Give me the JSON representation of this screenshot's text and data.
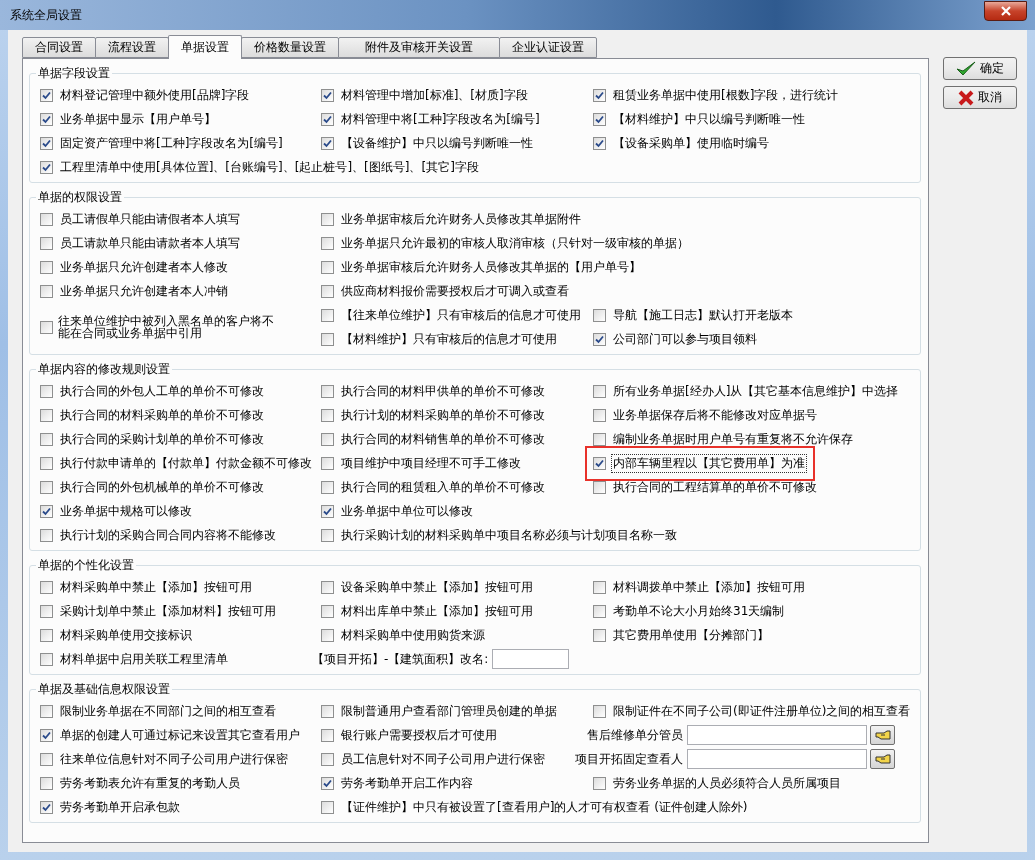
{
  "window": {
    "title": "系统全局设置"
  },
  "tabs": [
    {
      "label": "合同设置",
      "selected": false
    },
    {
      "label": "流程设置",
      "selected": false
    },
    {
      "label": "单据设置",
      "selected": true
    },
    {
      "label": "价格数量设置",
      "selected": false
    },
    {
      "label": "附件及审核开关设置",
      "selected": false
    },
    {
      "label": "企业认证设置",
      "selected": false
    }
  ],
  "buttons": [
    {
      "label": "确定",
      "kind": "ok"
    },
    {
      "label": "取消",
      "kind": "cancel"
    }
  ],
  "groups": [
    {
      "title": "单据字段设置",
      "items": [
        {
          "kind": "checkbox",
          "label": "材料登记管理中额外使用[品牌]字段",
          "checked": true
        },
        {
          "kind": "checkbox",
          "label": "材料管理中增加[标准]、[材质]字段",
          "checked": true
        },
        {
          "kind": "checkbox",
          "label": "租赁业务单据中使用[根数]字段，进行统计",
          "checked": true
        },
        {
          "kind": "checkbox",
          "label": "业务单据中显示【用户单号】",
          "checked": true
        },
        {
          "kind": "checkbox",
          "label": "材料管理中将[工种]字段改名为[编号]",
          "checked": true
        },
        {
          "kind": "checkbox",
          "label": "【材料维护】中只以编号判断唯一性",
          "checked": true
        },
        {
          "kind": "checkbox",
          "label": "固定资产管理中将[工种]字段改名为[编号]",
          "checked": true
        },
        {
          "kind": "checkbox",
          "label": "【设备维护】中只以编号判断唯一性",
          "checked": true
        },
        {
          "kind": "checkbox",
          "label": "【设备采购单】使用临时编号",
          "checked": true
        },
        {
          "kind": "checkbox",
          "label": "工程里清单中使用[具体位置]、[台账编号]、[起止桩号]、[图纸号]、[其它]字段",
          "checked": true
        }
      ]
    },
    {
      "title": "单据的权限设置",
      "items": [
        {
          "kind": "checkbox",
          "label": "员工请假单只能由请假者本人填写",
          "checked": false
        },
        {
          "kind": "checkbox",
          "label": "业务单据审核后允许财务人员修改其单据附件",
          "checked": false
        },
        {
          "kind": "blank"
        },
        {
          "kind": "checkbox",
          "label": "员工请款单只能由请款者本人填写",
          "checked": false
        },
        {
          "kind": "checkbox",
          "label": "业务单据只允许最初的审核人取消审核（只针对一级审核的单据）",
          "checked": false
        },
        {
          "kind": "blank"
        },
        {
          "kind": "checkbox",
          "label": "业务单据只允许创建者本人修改",
          "checked": false
        },
        {
          "kind": "checkbox",
          "label": "业务单据审核后允许财务人员修改其单据的【用户单号】",
          "checked": false
        },
        {
          "kind": "blank"
        },
        {
          "kind": "checkbox",
          "label": "业务单据只允许创建者本人冲销",
          "checked": false
        },
        {
          "kind": "checkbox",
          "label": "供应商材料报价需要授权后才可调入或查看",
          "checked": false
        },
        {
          "kind": "blank"
        },
        {
          "kind": "wrapped-checkbox",
          "label": "往来单位维护中被列入黑名单的客户将不能在合同或业务单据中引用",
          "checked": false
        },
        {
          "kind": "checkbox",
          "label": "【往来单位维护】只有审核后的信息才可使用",
          "checked": false
        },
        {
          "kind": "checkbox",
          "label": "导航【施工日志】默认打开老版本",
          "checked": false
        },
        {
          "kind": "checkbox",
          "label": "【材料维护】只有审核后的信息才可使用",
          "checked": false
        },
        {
          "kind": "checkbox",
          "label": "公司部门可以参与项目领料",
          "checked": true
        }
      ]
    },
    {
      "title": "单据内容的修改规则设置",
      "items": [
        {
          "kind": "checkbox",
          "label": "执行合同的外包人工单的单价不可修改",
          "checked": false
        },
        {
          "kind": "checkbox",
          "label": "执行合同的材料甲供单的单价不可修改",
          "checked": false
        },
        {
          "kind": "checkbox",
          "label": "所有业务单据[经办人]从【其它基本信息维护】中选择",
          "checked": false
        },
        {
          "kind": "checkbox",
          "label": "执行合同的材料采购单的单价不可修改",
          "checked": false
        },
        {
          "kind": "checkbox",
          "label": "执行计划的材料采购单的单价不可修改",
          "checked": false
        },
        {
          "kind": "checkbox",
          "label": "业务单据保存后将不能修改对应单据号",
          "checked": false
        },
        {
          "kind": "checkbox",
          "label": "执行合同的采购计划单的单价不可修改",
          "checked": false
        },
        {
          "kind": "checkbox",
          "label": "执行合同的材料销售单的单价不可修改",
          "checked": false
        },
        {
          "kind": "checkbox",
          "label": "编制业务单据时用户单号有重复将不允许保存",
          "checked": false
        },
        {
          "kind": "checkbox",
          "label": "执行付款申请单的【付款单】付款金额不可修改",
          "checked": false
        },
        {
          "kind": "checkbox",
          "label": "项目维护中项目经理不可手工修改",
          "checked": false
        },
        {
          "kind": "checkbox",
          "label": "内部车辆里程以【其它费用单】为准",
          "checked": true,
          "highlighted": true
        },
        {
          "kind": "checkbox",
          "label": "执行合同的外包机械单的单价不可修改",
          "checked": false
        },
        {
          "kind": "checkbox",
          "label": "执行合同的租赁租入单的单价不可修改",
          "checked": false
        },
        {
          "kind": "checkbox",
          "label": "执行合同的工程结算单的单价不可修改",
          "checked": false
        },
        {
          "kind": "checkbox",
          "label": "业务单据中规格可以修改",
          "checked": true
        },
        {
          "kind": "checkbox",
          "label": "业务单据中单位可以修改",
          "checked": true
        },
        {
          "kind": "blank"
        },
        {
          "kind": "checkbox",
          "label": "执行计划的采购合同合同内容将不能修改",
          "checked": false
        },
        {
          "kind": "checkbox",
          "label": "执行采购计划的材料采购单中项目名称必须与计划项目名称一致",
          "checked": false
        }
      ]
    },
    {
      "title": "单据的个性化设置",
      "items": [
        {
          "kind": "checkbox",
          "label": "材料采购单中禁止【添加】按钮可用",
          "checked": false
        },
        {
          "kind": "checkbox",
          "label": "设备采购单中禁止【添加】按钮可用",
          "checked": false
        },
        {
          "kind": "checkbox",
          "label": "材料调拨单中禁止【添加】按钮可用",
          "checked": false
        },
        {
          "kind": "checkbox",
          "label": "采购计划单中禁止【添加材料】按钮可用",
          "checked": false
        },
        {
          "kind": "checkbox",
          "label": "材料出库单中禁止【添加】按钮可用",
          "checked": false
        },
        {
          "kind": "checkbox",
          "label": "考勤单不论大小月始终31天编制",
          "checked": false
        },
        {
          "kind": "checkbox",
          "label": "材料采购单使用交接标识",
          "checked": false
        },
        {
          "kind": "checkbox",
          "label": "材料采购单中使用购货来源",
          "checked": false
        },
        {
          "kind": "checkbox",
          "label": "其它费用单使用【分摊部门】",
          "checked": false
        },
        {
          "kind": "checkbox",
          "label": "材料单据中启用关联工程里清单",
          "checked": false
        },
        {
          "kind": "text-field",
          "label": "【项目开拓】-【建筑面积】改名:"
        }
      ]
    },
    {
      "title": "单据及基础信息权限设置",
      "items": [
        {
          "kind": "checkbox",
          "label": "限制业务单据在不同部门之间的相互查看",
          "checked": false
        },
        {
          "kind": "checkbox",
          "label": "限制普通用户查看部门管理员创建的单据",
          "checked": false
        },
        {
          "kind": "checkbox",
          "label": "限制证件在不同子公司(即证件注册单位)之间的相互查看",
          "checked": false
        },
        {
          "kind": "checkbox",
          "label": "单据的创建人可通过标记来设置其它查看用户",
          "checked": true
        },
        {
          "kind": "checkbox",
          "label": "银行账户需要授权后才可使用",
          "checked": false
        },
        {
          "kind": "picker-field",
          "label": "售后维修单分管员"
        },
        {
          "kind": "checkbox",
          "label": "往来单位信息针对不同子公司用户进行保密",
          "checked": false
        },
        {
          "kind": "checkbox",
          "label": "员工信息针对不同子公司用户进行保密",
          "checked": false
        },
        {
          "kind": "picker-field",
          "label": "项目开拓固定查看人"
        },
        {
          "kind": "checkbox",
          "label": "劳务考勤表允许有重复的考勤人员",
          "checked": false
        },
        {
          "kind": "checkbox",
          "label": "劳务考勤单开启工作内容",
          "checked": true
        },
        {
          "kind": "checkbox",
          "label": "劳务业务单据的人员必须符合人员所属项目",
          "checked": false
        },
        {
          "kind": "checkbox",
          "label": "劳务考勤单开启承包款",
          "checked": true
        },
        {
          "kind": "checkbox",
          "label": "【证件维护】中只有被设置了[查看用户]的人才可有权查看 (证件创建人除外)",
          "checked": false
        }
      ]
    }
  ]
}
